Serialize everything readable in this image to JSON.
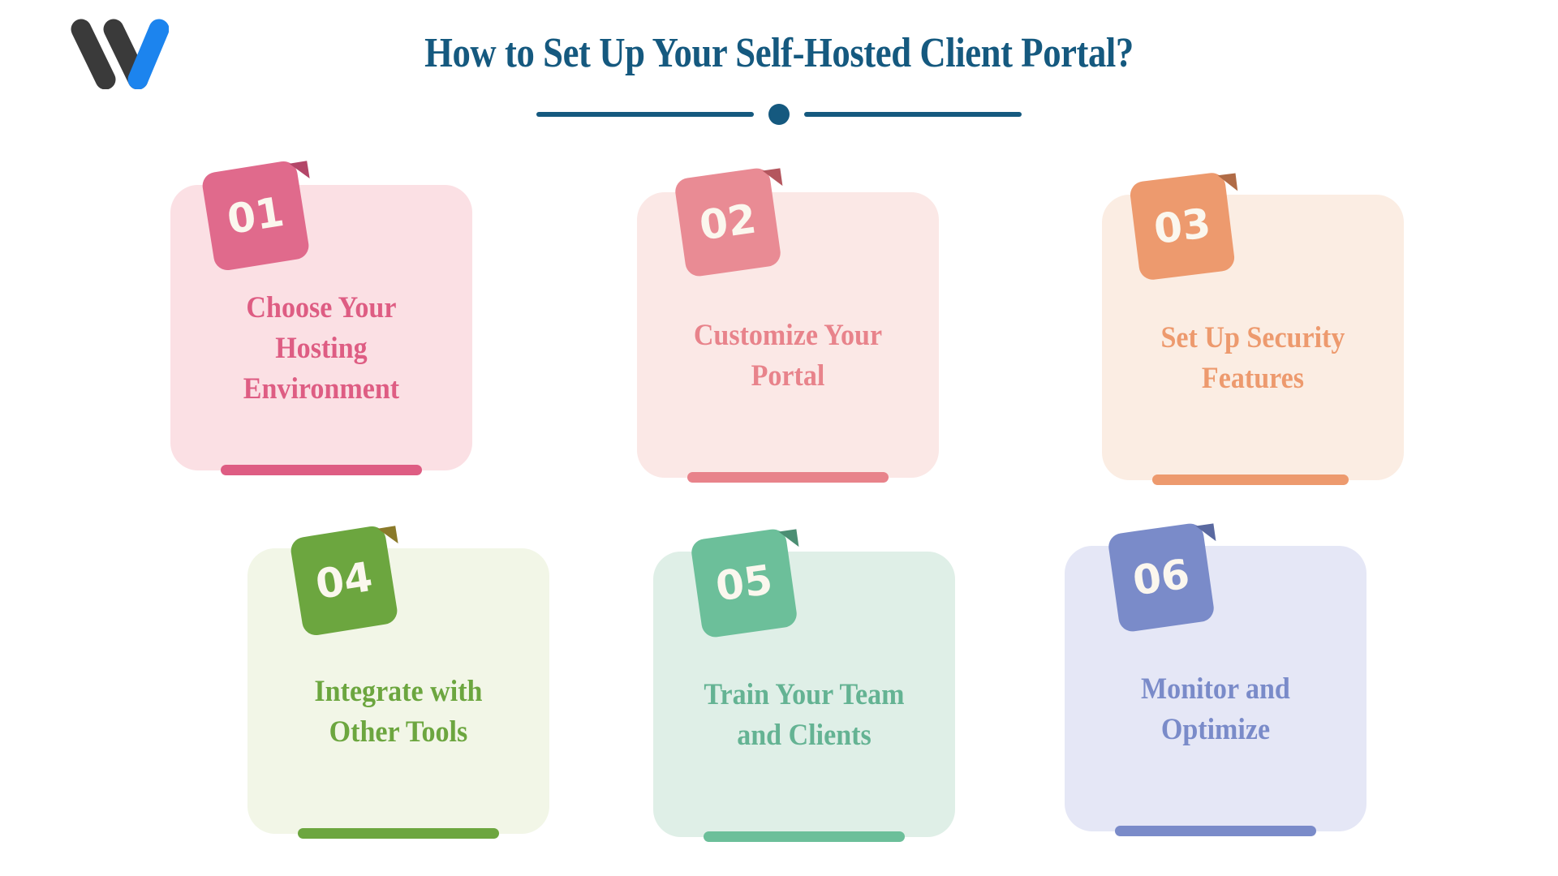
{
  "brand": {
    "logo_name": "w-logo",
    "logo_dark_color": "#3A3A3A",
    "logo_accent_color": "#1C84EE"
  },
  "header": {
    "title": "How to Set Up Your Self-Hosted Client Portal?",
    "title_color": "#15597F",
    "divider_color": "#15597F"
  },
  "cards": [
    {
      "number": "01",
      "title": "Choose Your Hosting Environment",
      "badge_color": "#E06A8C",
      "fold_color": "#B34668",
      "body_color": "#FBE0E4",
      "text_color": "#DE5D83",
      "bar_color": "#DE5D83"
    },
    {
      "number": "02",
      "title": "Customize Your Portal",
      "badge_color": "#E98B94",
      "fold_color": "#B4565E",
      "body_color": "#FBE8E6",
      "text_color": "#E8838B",
      "bar_color": "#E8838B"
    },
    {
      "number": "03",
      "title": "Set Up Security Features",
      "badge_color": "#ED9A6E",
      "fold_color": "#B06B46",
      "body_color": "#FBEDE3",
      "text_color": "#ED9A6E",
      "bar_color": "#ED9A6E"
    },
    {
      "number": "04",
      "title": "Integrate with Other Tools",
      "badge_color": "#6CA63F",
      "fold_color": "#8A7A2A",
      "body_color": "#F2F6E7",
      "text_color": "#6CA63F",
      "bar_color": "#6CA63F"
    },
    {
      "number": "05",
      "title": "Train Your Team and Clients",
      "badge_color": "#6CBF9A",
      "fold_color": "#4B8E73",
      "body_color": "#DFEFE7",
      "text_color": "#64B393",
      "bar_color": "#6CBF9A"
    },
    {
      "number": "06",
      "title": "Monitor and Optimize",
      "badge_color": "#7A8BC9",
      "fold_color": "#5A69A0",
      "body_color": "#E5E7F6",
      "text_color": "#7A8BC9",
      "bar_color": "#7A8BC9"
    }
  ]
}
